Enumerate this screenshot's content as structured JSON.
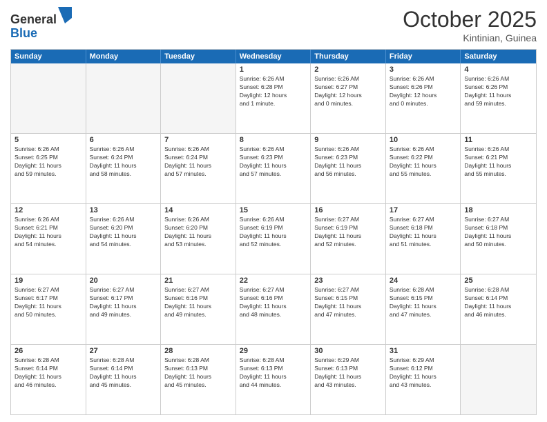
{
  "header": {
    "logo_general": "General",
    "logo_blue": "Blue",
    "month": "October 2025",
    "location": "Kintinian, Guinea"
  },
  "days": [
    "Sunday",
    "Monday",
    "Tuesday",
    "Wednesday",
    "Thursday",
    "Friday",
    "Saturday"
  ],
  "rows": [
    [
      {
        "day": "",
        "empty": true
      },
      {
        "day": "",
        "empty": true
      },
      {
        "day": "",
        "empty": true
      },
      {
        "day": "1",
        "info": "Sunrise: 6:26 AM\nSunset: 6:28 PM\nDaylight: 12 hours\nand 1 minute."
      },
      {
        "day": "2",
        "info": "Sunrise: 6:26 AM\nSunset: 6:27 PM\nDaylight: 12 hours\nand 0 minutes."
      },
      {
        "day": "3",
        "info": "Sunrise: 6:26 AM\nSunset: 6:26 PM\nDaylight: 12 hours\nand 0 minutes."
      },
      {
        "day": "4",
        "info": "Sunrise: 6:26 AM\nSunset: 6:26 PM\nDaylight: 11 hours\nand 59 minutes."
      }
    ],
    [
      {
        "day": "5",
        "info": "Sunrise: 6:26 AM\nSunset: 6:25 PM\nDaylight: 11 hours\nand 59 minutes."
      },
      {
        "day": "6",
        "info": "Sunrise: 6:26 AM\nSunset: 6:24 PM\nDaylight: 11 hours\nand 58 minutes."
      },
      {
        "day": "7",
        "info": "Sunrise: 6:26 AM\nSunset: 6:24 PM\nDaylight: 11 hours\nand 57 minutes."
      },
      {
        "day": "8",
        "info": "Sunrise: 6:26 AM\nSunset: 6:23 PM\nDaylight: 11 hours\nand 57 minutes."
      },
      {
        "day": "9",
        "info": "Sunrise: 6:26 AM\nSunset: 6:23 PM\nDaylight: 11 hours\nand 56 minutes."
      },
      {
        "day": "10",
        "info": "Sunrise: 6:26 AM\nSunset: 6:22 PM\nDaylight: 11 hours\nand 55 minutes."
      },
      {
        "day": "11",
        "info": "Sunrise: 6:26 AM\nSunset: 6:21 PM\nDaylight: 11 hours\nand 55 minutes."
      }
    ],
    [
      {
        "day": "12",
        "info": "Sunrise: 6:26 AM\nSunset: 6:21 PM\nDaylight: 11 hours\nand 54 minutes."
      },
      {
        "day": "13",
        "info": "Sunrise: 6:26 AM\nSunset: 6:20 PM\nDaylight: 11 hours\nand 54 minutes."
      },
      {
        "day": "14",
        "info": "Sunrise: 6:26 AM\nSunset: 6:20 PM\nDaylight: 11 hours\nand 53 minutes."
      },
      {
        "day": "15",
        "info": "Sunrise: 6:26 AM\nSunset: 6:19 PM\nDaylight: 11 hours\nand 52 minutes."
      },
      {
        "day": "16",
        "info": "Sunrise: 6:27 AM\nSunset: 6:19 PM\nDaylight: 11 hours\nand 52 minutes."
      },
      {
        "day": "17",
        "info": "Sunrise: 6:27 AM\nSunset: 6:18 PM\nDaylight: 11 hours\nand 51 minutes."
      },
      {
        "day": "18",
        "info": "Sunrise: 6:27 AM\nSunset: 6:18 PM\nDaylight: 11 hours\nand 50 minutes."
      }
    ],
    [
      {
        "day": "19",
        "info": "Sunrise: 6:27 AM\nSunset: 6:17 PM\nDaylight: 11 hours\nand 50 minutes."
      },
      {
        "day": "20",
        "info": "Sunrise: 6:27 AM\nSunset: 6:17 PM\nDaylight: 11 hours\nand 49 minutes."
      },
      {
        "day": "21",
        "info": "Sunrise: 6:27 AM\nSunset: 6:16 PM\nDaylight: 11 hours\nand 49 minutes."
      },
      {
        "day": "22",
        "info": "Sunrise: 6:27 AM\nSunset: 6:16 PM\nDaylight: 11 hours\nand 48 minutes."
      },
      {
        "day": "23",
        "info": "Sunrise: 6:27 AM\nSunset: 6:15 PM\nDaylight: 11 hours\nand 47 minutes."
      },
      {
        "day": "24",
        "info": "Sunrise: 6:28 AM\nSunset: 6:15 PM\nDaylight: 11 hours\nand 47 minutes."
      },
      {
        "day": "25",
        "info": "Sunrise: 6:28 AM\nSunset: 6:14 PM\nDaylight: 11 hours\nand 46 minutes."
      }
    ],
    [
      {
        "day": "26",
        "info": "Sunrise: 6:28 AM\nSunset: 6:14 PM\nDaylight: 11 hours\nand 46 minutes."
      },
      {
        "day": "27",
        "info": "Sunrise: 6:28 AM\nSunset: 6:14 PM\nDaylight: 11 hours\nand 45 minutes."
      },
      {
        "day": "28",
        "info": "Sunrise: 6:28 AM\nSunset: 6:13 PM\nDaylight: 11 hours\nand 45 minutes."
      },
      {
        "day": "29",
        "info": "Sunrise: 6:28 AM\nSunset: 6:13 PM\nDaylight: 11 hours\nand 44 minutes."
      },
      {
        "day": "30",
        "info": "Sunrise: 6:29 AM\nSunset: 6:13 PM\nDaylight: 11 hours\nand 43 minutes."
      },
      {
        "day": "31",
        "info": "Sunrise: 6:29 AM\nSunset: 6:12 PM\nDaylight: 11 hours\nand 43 minutes."
      },
      {
        "day": "",
        "empty": true
      }
    ]
  ]
}
